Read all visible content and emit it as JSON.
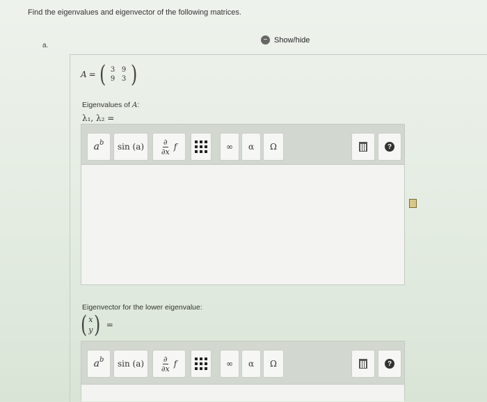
{
  "question": {
    "text": "Find the eigenvalues and eigenvector of the following matrices."
  },
  "part": {
    "letter": "a.",
    "showhide_label": "Show/hide",
    "showhide_icon": "minus-icon"
  },
  "matrix": {
    "label": "A",
    "equals": "=",
    "rows": [
      [
        "3",
        "9"
      ],
      [
        "9",
        "3"
      ]
    ]
  },
  "eigenvalues": {
    "label_text": "Eigenvalues of ",
    "label_var": "A",
    "label_suffix": ":",
    "expr": "λ₁, λ₂ ="
  },
  "eigenvector": {
    "label": "Eigenvector for the lower eigenvalue:",
    "vec_top": "x",
    "vec_bottom": "y",
    "equals": "="
  },
  "toolbar": {
    "power_base": "a",
    "power_exp": "b",
    "sin_label": "sin (a)",
    "deriv_num": "∂",
    "deriv_den": "∂x",
    "deriv_f": "f",
    "infinity": "∞",
    "alpha": "α",
    "omega": "Ω",
    "help": "?"
  }
}
